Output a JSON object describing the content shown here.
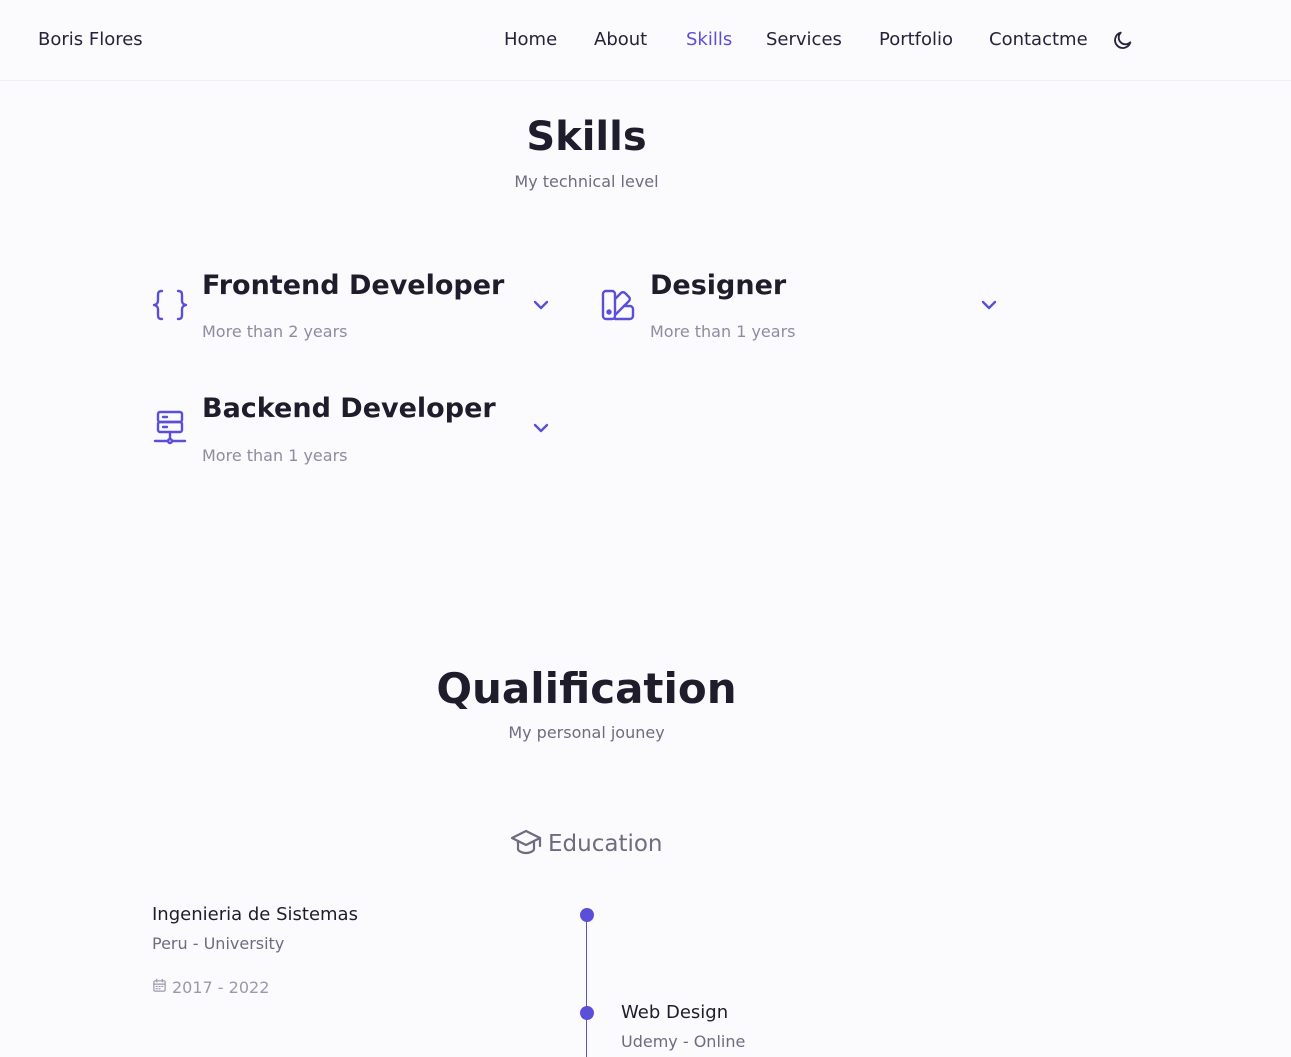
{
  "header": {
    "logo": "Boris Flores",
    "nav": [
      {
        "label": "Home"
      },
      {
        "label": "About"
      },
      {
        "label": "Skills"
      },
      {
        "label": "Services"
      },
      {
        "label": "Portfolio"
      },
      {
        "label": "Contactme"
      }
    ],
    "active_nav": "Skills",
    "theme_toggle_icon": "moon-icon"
  },
  "skills": {
    "title": "Skills",
    "subtitle": "My technical level",
    "items": [
      {
        "icon": "code-braces-icon",
        "title": "Frontend Developer",
        "subtitle": "More than 2 years"
      },
      {
        "icon": "swatchbook-icon",
        "title": "Designer",
        "subtitle": "More than 1 years"
      },
      {
        "icon": "server-network-icon",
        "title": "Backend Developer",
        "subtitle": "More than 1 years"
      }
    ]
  },
  "qualification": {
    "title": "Qualification",
    "subtitle": "My personal jouney",
    "tab": {
      "icon": "graduation-cap-icon",
      "label": "Education"
    },
    "entries": [
      {
        "title": "Ingenieria de Sistemas",
        "subtitle": "Peru - University",
        "date": "2017 - 2022",
        "side": "left"
      },
      {
        "title": "Web Design",
        "subtitle": "Udemy - Online",
        "side": "right"
      }
    ]
  },
  "colors": {
    "accent": "#5b4fd8",
    "text": "#1f1c2b",
    "muted": "#8f8ba0",
    "background": "#fbfbfe"
  }
}
